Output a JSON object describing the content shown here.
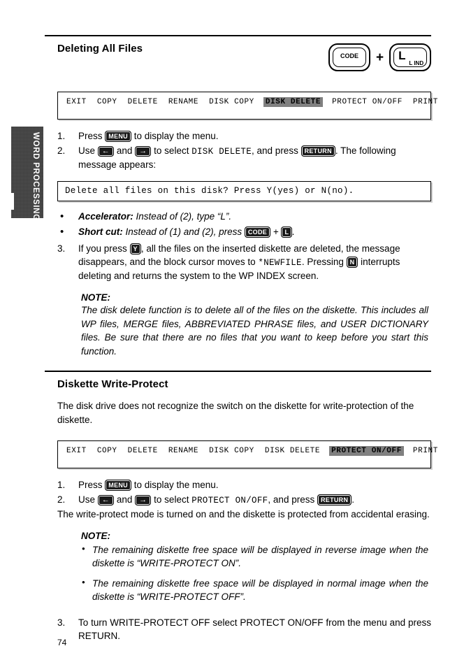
{
  "side_tab": {
    "label": "WORD PROCESSING"
  },
  "page_number": "74",
  "keycaps": {
    "code_key": "CODE",
    "plus": "+",
    "l_key_main": "L",
    "l_key_sub": "L IND"
  },
  "section1": {
    "title": "Deleting All Files",
    "menu": {
      "items": [
        {
          "label": "EXIT",
          "selected": false
        },
        {
          "label": "COPY",
          "selected": false
        },
        {
          "label": "DELETE",
          "selected": false
        },
        {
          "label": "RENAME",
          "selected": false
        },
        {
          "label": "DISK COPY",
          "selected": false
        },
        {
          "label": "DISK DELETE",
          "selected": true
        },
        {
          "label": "PROTECT ON/OFF",
          "selected": false
        },
        {
          "label": "PRINT",
          "selected": false
        }
      ]
    },
    "steps": [
      {
        "num": "1.",
        "text_a": "Press ",
        "key1": "MENU",
        "text_b": " to display the menu."
      },
      {
        "num": "2.",
        "text_a": "Use ",
        "key_left": "←",
        "text_b": " and ",
        "key_right": "→",
        "text_c": " to select ",
        "mono1": "DISK DELETE",
        "text_d": ", and press ",
        "key2": "RETURN",
        "text_e": ". The following message appears:"
      }
    ],
    "message_box": "Delete all files on this disk?  Press Y(yes) or N(no).",
    "bullets": [
      {
        "lead": "Accelerator:",
        "text": " Instead of (2), type “L”."
      },
      {
        "lead": "Short cut:",
        "text_a": " Instead of (1) and (2), press ",
        "key1": "CODE",
        "plus": " + ",
        "key2": "L",
        "text_b": "."
      }
    ],
    "step3": {
      "num": "3.",
      "text_a": "If you press ",
      "key1": "Y",
      "text_b": ", all the files on the inserted diskette are deleted, the message disappears, and the block cursor moves to ",
      "mono1": "*NEWFILE",
      "text_c": ". Pressing ",
      "key2": "N",
      "text_d": " interrupts deleting and returns the system to the WP INDEX screen."
    },
    "note": {
      "title": "NOTE:",
      "body": "The disk delete function is to delete all of the files on the diskette. This includes all WP files, MERGE files, ABBREVIATED PHRASE files, and USER DICTIONARY files. Be sure that there are no files that you want to keep before you start this function."
    }
  },
  "section2": {
    "title": "Diskette Write-Protect",
    "intro": "The disk drive does not recognize the switch on the diskette for write-protection of the diskette.",
    "menu": {
      "items": [
        {
          "label": "EXIT",
          "selected": false
        },
        {
          "label": "COPY",
          "selected": false
        },
        {
          "label": "DELETE",
          "selected": false
        },
        {
          "label": "RENAME",
          "selected": false
        },
        {
          "label": "DISK COPY",
          "selected": false
        },
        {
          "label": "DISK DELETE",
          "selected": false
        },
        {
          "label": "PROTECT ON/OFF",
          "selected": true
        },
        {
          "label": "PRINT",
          "selected": false
        }
      ]
    },
    "steps": [
      {
        "num": "1.",
        "text_a": "Press ",
        "key1": "MENU",
        "text_b": " to display the menu."
      },
      {
        "num": "2.",
        "text_a": "Use ",
        "key_left": "←",
        "text_b": " and ",
        "key_right": "→",
        "text_c": " to select ",
        "mono1": "PROTECT ON/OFF",
        "text_d": ", and press ",
        "key2": "RETURN",
        "text_e": "."
      }
    ],
    "after_steps": "The write-protect mode is turned on and the diskette is protected from accidental erasing.",
    "note": {
      "title": "NOTE:",
      "bullets": [
        "The remaining diskette free space will be displayed in reverse image when the diskette is “WRITE-PROTECT ON”.",
        "The remaining diskette free space will be displayed in normal image when the diskette is “WRITE-PROTECT OFF”."
      ]
    },
    "step3": {
      "num": "3.",
      "text": "To turn WRITE-PROTECT OFF select PROTECT ON/OFF from the menu and press RETURN."
    }
  }
}
